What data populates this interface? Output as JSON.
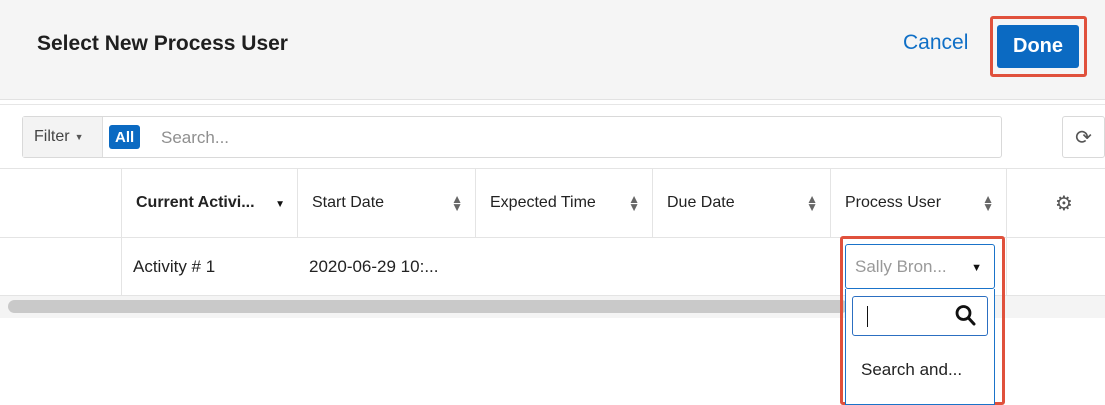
{
  "header": {
    "title": "Select New Process User",
    "cancel_label": "Cancel",
    "done_label": "Done"
  },
  "filter": {
    "label": "Filter",
    "all_label": "All",
    "search_placeholder": "Search..."
  },
  "columns": [
    "Current Activi...",
    "Start Date",
    "Expected Time",
    "Due Date",
    "Process User"
  ],
  "rows": [
    {
      "activity": "Activity # 1",
      "start_date": "2020-06-29 10:...",
      "expected_time": "",
      "due_date": ""
    }
  ],
  "process_user_select": {
    "value": "Sally Bron...",
    "search_value": "",
    "option_label": "Search and..."
  },
  "colors": {
    "accent": "#0b6ac2",
    "link": "#0f6fc6",
    "highlight": "#e0513c"
  }
}
